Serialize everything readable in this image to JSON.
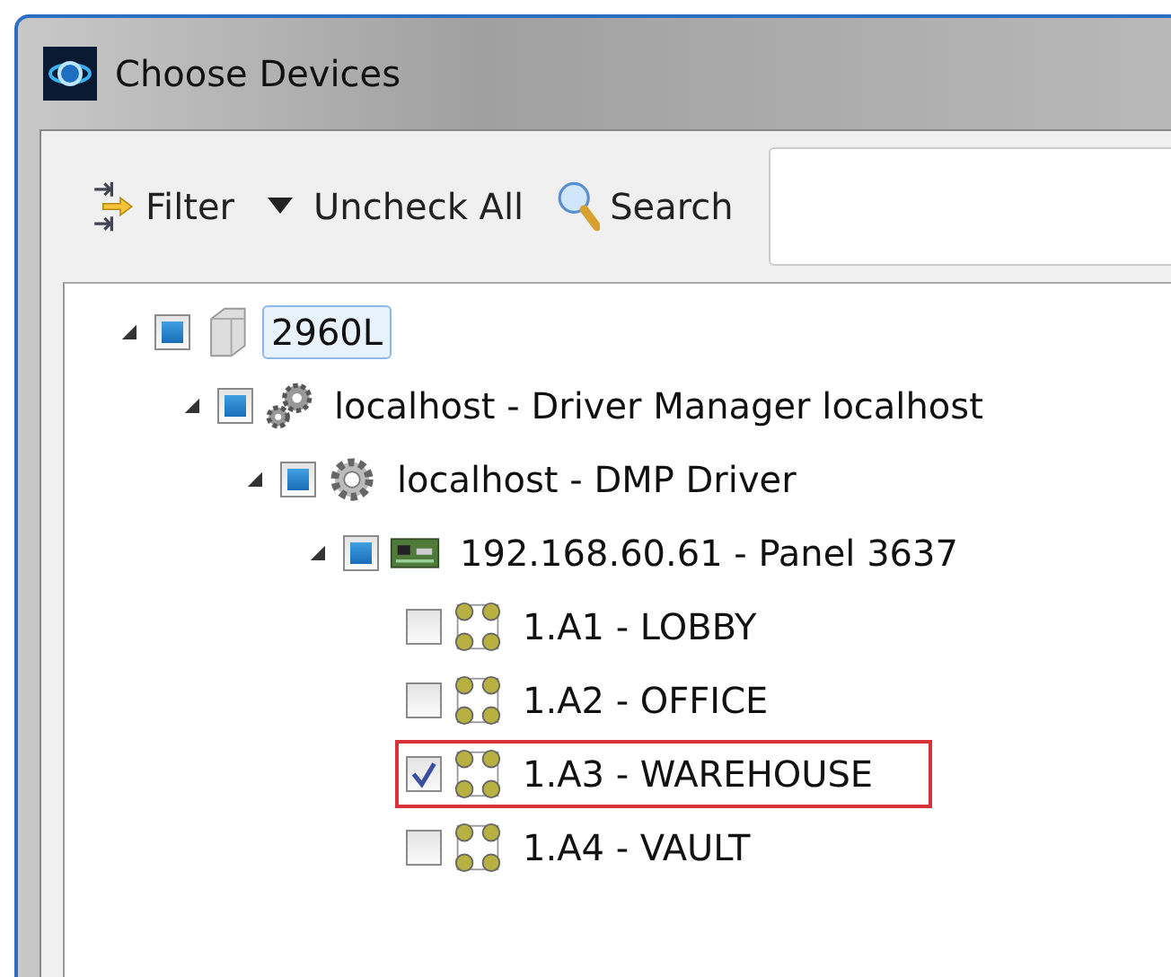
{
  "window": {
    "title": "Choose Devices"
  },
  "toolbar": {
    "filter": "Filter",
    "uncheck_all": "Uncheck All",
    "search": "Search"
  },
  "tree": [
    {
      "label": "2960L",
      "kind": "server",
      "expanded": true,
      "checked": false,
      "partial": true,
      "selected": true,
      "highlighted": false,
      "children": [
        {
          "label": "localhost - Driver Manager localhost",
          "kind": "gears",
          "expanded": true,
          "checked": false,
          "partial": true,
          "selected": false,
          "highlighted": false,
          "children": [
            {
              "label": "localhost - DMP Driver",
              "kind": "gear",
              "expanded": true,
              "checked": false,
              "partial": true,
              "selected": false,
              "highlighted": false,
              "children": [
                {
                  "label": "192.168.60.61 - Panel 3637",
                  "kind": "board",
                  "expanded": true,
                  "checked": false,
                  "partial": true,
                  "selected": false,
                  "highlighted": false,
                  "children": [
                    {
                      "label": "1.A1 - LOBBY",
                      "kind": "zone",
                      "checked": false,
                      "partial": false,
                      "selected": false,
                      "highlighted": false
                    },
                    {
                      "label": "1.A2 - OFFICE",
                      "kind": "zone",
                      "checked": false,
                      "partial": false,
                      "selected": false,
                      "highlighted": false
                    },
                    {
                      "label": "1.A3 - WAREHOUSE",
                      "kind": "zone",
                      "checked": true,
                      "partial": false,
                      "selected": false,
                      "highlighted": true
                    },
                    {
                      "label": "1.A4 - VAULT",
                      "kind": "zone",
                      "checked": false,
                      "partial": false,
                      "selected": false,
                      "highlighted": false
                    }
                  ]
                }
              ]
            }
          ]
        }
      ]
    }
  ]
}
